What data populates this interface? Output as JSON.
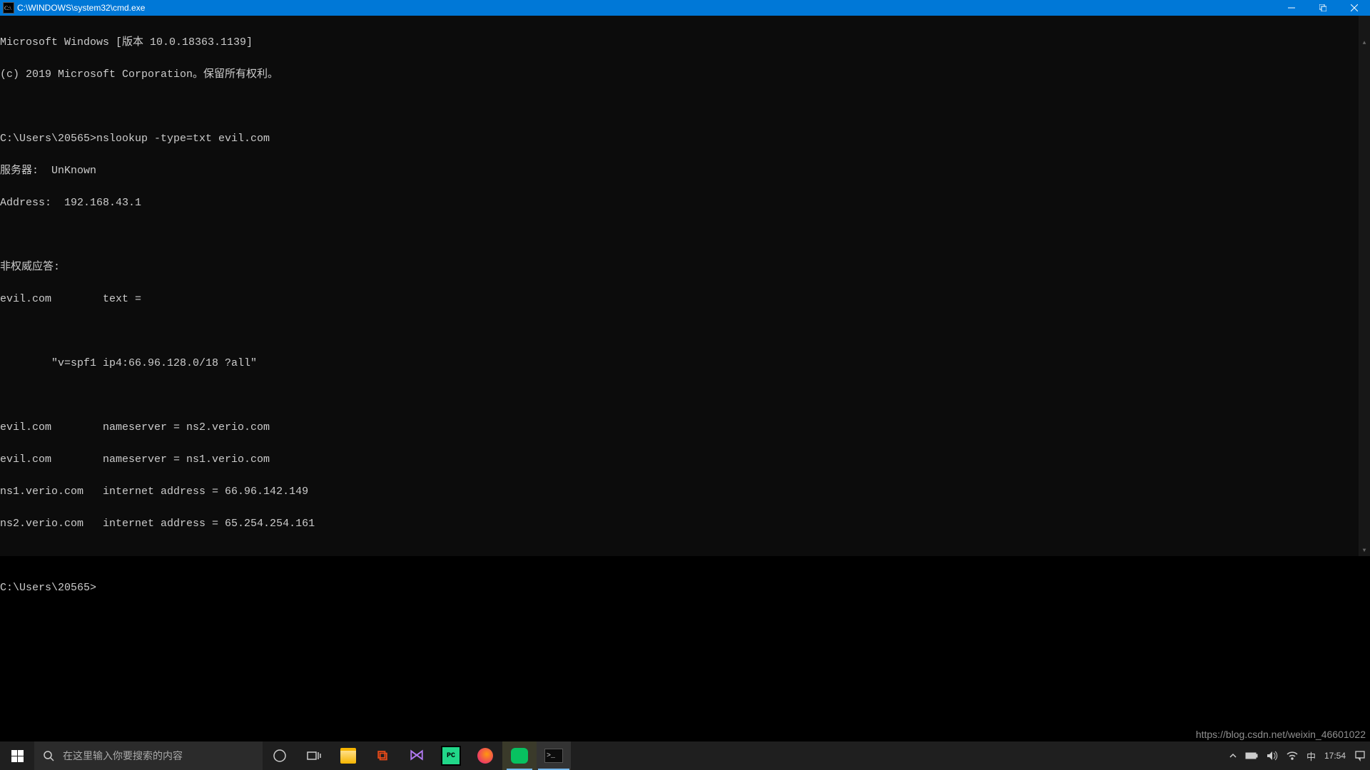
{
  "window": {
    "title": "C:\\WINDOWS\\system32\\cmd.exe"
  },
  "terminal": {
    "lines": [
      "Microsoft Windows [版本 10.0.18363.1139]",
      "(c) 2019 Microsoft Corporation。保留所有权利。",
      "",
      "C:\\Users\\20565>nslookup -type=txt evil.com",
      "服务器:  UnKnown",
      "Address:  192.168.43.1",
      "",
      "非权威应答:",
      "evil.com        text =",
      "",
      "        \"v=spf1 ip4:66.96.128.0/18 ?all\"",
      "",
      "evil.com        nameserver = ns2.verio.com",
      "evil.com        nameserver = ns1.verio.com",
      "ns1.verio.com   internet address = 66.96.142.149",
      "ns2.verio.com   internet address = 65.254.254.161",
      "",
      "C:\\Users\\20565>"
    ]
  },
  "taskbar": {
    "search_placeholder": "在这里输入你要搜索的内容",
    "clock_time": "17:54"
  },
  "watermark": "https://blog.csdn.net/weixin_46601022"
}
